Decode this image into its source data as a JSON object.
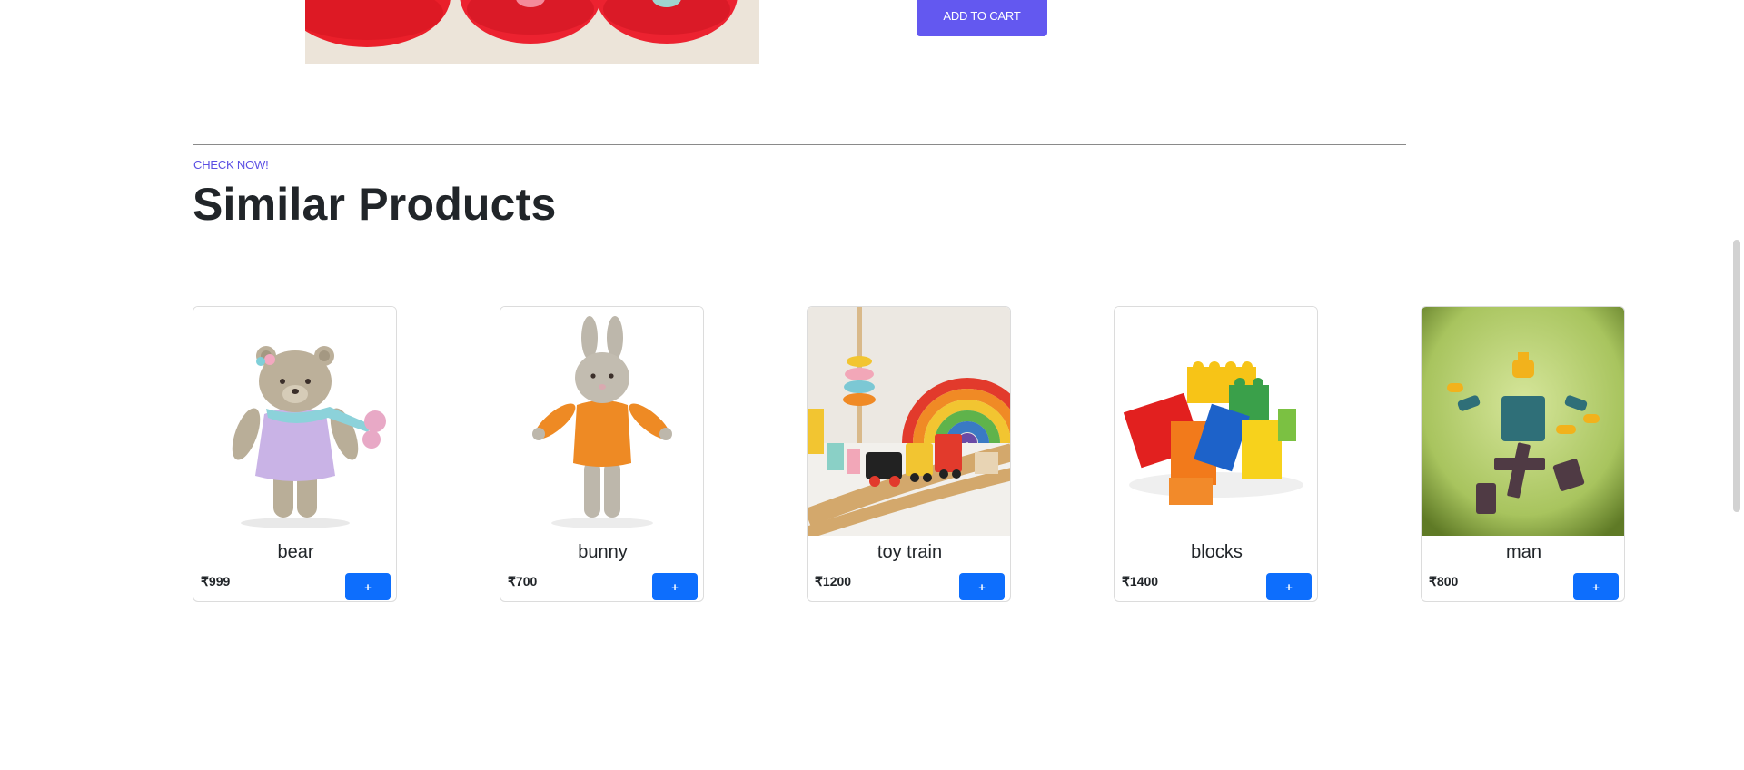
{
  "product": {
    "add_to_cart_label": "ADD TO CART"
  },
  "similar": {
    "eyebrow": "CHECK NOW!",
    "title": "Similar Products",
    "add_label": "+",
    "items": [
      {
        "name": "bear",
        "price": "₹999"
      },
      {
        "name": "bunny",
        "price": "₹700"
      },
      {
        "name": "toy train",
        "price": "₹1200"
      },
      {
        "name": "blocks",
        "price": "₹1400"
      },
      {
        "name": "man",
        "price": "₹800"
      }
    ]
  },
  "colors": {
    "accent_purple": "#6358f0",
    "button_blue": "#0d6efd",
    "text_dark": "#212529"
  }
}
